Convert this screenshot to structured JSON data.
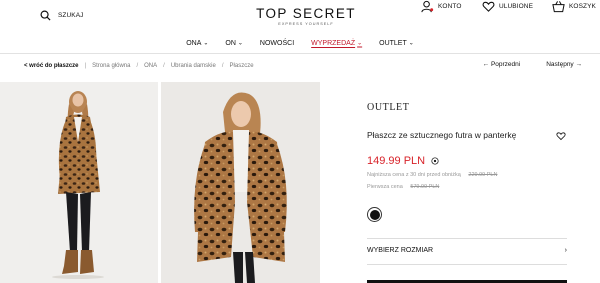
{
  "header": {
    "search_label": "SZUKAJ",
    "logo": "TOP SECRET",
    "logo_tagline": "EXPRESS YOURSELF",
    "account_label": "KONTO",
    "favorites_label": "ULUBIONE",
    "cart_label": "KOSZYK"
  },
  "nav": {
    "items": [
      {
        "label": "ONA",
        "has_dropdown": true
      },
      {
        "label": "ON",
        "has_dropdown": true
      },
      {
        "label": "NOWOŚCI",
        "has_dropdown": false
      },
      {
        "label": "WYPRZEDAŻ",
        "has_dropdown": true
      },
      {
        "label": "OUTLET",
        "has_dropdown": true
      }
    ],
    "sale_color": "#c2182b"
  },
  "breadcrumb": {
    "back": "< wróć do płaszcze",
    "crumbs": [
      "Strona główna",
      "ONA",
      "Ubrania damskie",
      "Płaszcze"
    ]
  },
  "pager": {
    "prev": "Poprzedni",
    "next": "Następny"
  },
  "product": {
    "brand": "OUTLET",
    "title": "Płaszcz ze sztucznego futra w panterkę",
    "price": "149.99 PLN",
    "price_color": "#d8232a",
    "lowest_label": "Najniższa cena z 30 dni przed obniżką",
    "lowest_value": "229.99 PLN",
    "first_label": "Pierwsza cena",
    "first_value": "579.99 PLN",
    "color_swatch": "#111111",
    "size_label": "WYBIERZ ROZMIAR"
  },
  "icons": {
    "search": "search-icon",
    "account": "user-icon",
    "favorites": "heart-icon",
    "cart": "basket-icon"
  }
}
